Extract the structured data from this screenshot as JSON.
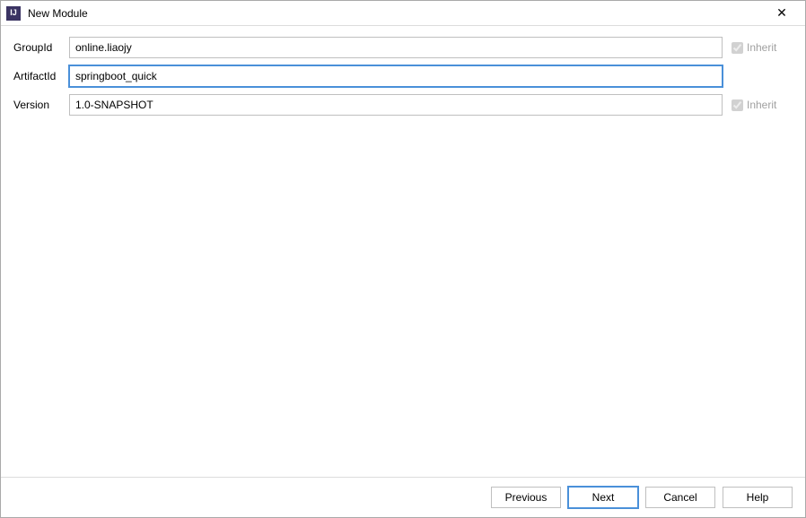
{
  "window": {
    "title": "New Module"
  },
  "form": {
    "groupId": {
      "label": "GroupId",
      "value": "online.liaojy",
      "inherit_label": "Inherit"
    },
    "artifactId": {
      "label": "ArtifactId",
      "value": "springboot_quick"
    },
    "version": {
      "label": "Version",
      "value": "1.0-SNAPSHOT",
      "inherit_label": "Inherit"
    }
  },
  "buttons": {
    "previous": "Previous",
    "next": "Next",
    "cancel": "Cancel",
    "help": "Help"
  }
}
